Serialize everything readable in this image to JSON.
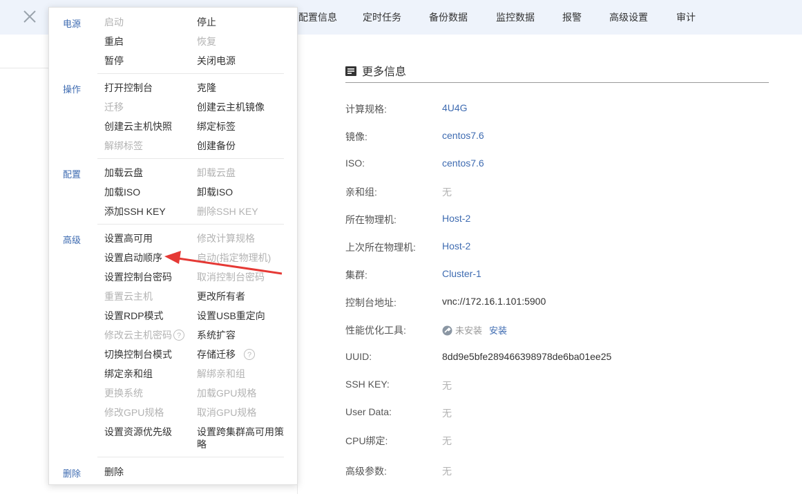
{
  "tabs": [
    "配置信息",
    "定时任务",
    "备份数据",
    "监控数据",
    "报警",
    "高级设置",
    "审计"
  ],
  "menu": {
    "groups": {
      "power": "电源",
      "ops": "操作",
      "config": "配置",
      "advanced": "高级",
      "delete": "删除"
    },
    "power": {
      "start": "启动",
      "stop": "停止",
      "restart": "重启",
      "resume": "恢复",
      "pause": "暂停",
      "poweroff": "关闭电源"
    },
    "ops": {
      "open_console": "打开控制台",
      "clone": "克隆",
      "migrate": "迁移",
      "create_image": "创建云主机镜像",
      "create_snapshot": "创建云主机快照",
      "bind_tag": "绑定标签",
      "unbind_tag": "解绑标签",
      "create_backup": "创建备份"
    },
    "config": {
      "attach_disk": "加载云盘",
      "detach_disk": "卸载云盘",
      "attach_iso": "加载ISO",
      "detach_iso": "卸载ISO",
      "add_ssh": "添加SSH KEY",
      "delete_ssh": "删除SSH KEY"
    },
    "advanced": {
      "set_ha": "设置高可用",
      "change_spec": "修改计算规格",
      "set_boot_order": "设置启动顺序",
      "start_on_host": "启动(指定物理机)",
      "set_console_pwd": "设置控制台密码",
      "cancel_console_pwd": "取消控制台密码",
      "reset_vm": "重置云主机",
      "change_owner": "更改所有者",
      "set_rdp": "设置RDP模式",
      "set_usb_redirect": "设置USB重定向",
      "change_vm_pwd": "修改云主机密码",
      "expand_disk": "系统扩容",
      "switch_console": "切换控制台模式",
      "storage_migrate": "存储迁移",
      "bind_affinity": "绑定亲和组",
      "unbind_affinity": "解绑亲和组",
      "change_os": "更换系统",
      "attach_gpu": "加载GPU规格",
      "change_gpu": "修改GPU规格",
      "cancel_gpu": "取消GPU规格",
      "set_priority": "设置资源优先级",
      "set_cross_cluster_ha": "设置跨集群高可用策略"
    },
    "delete": {
      "delete": "删除"
    },
    "help_glyph": "?"
  },
  "info": {
    "title": "更多信息",
    "rows": {
      "spec": {
        "label": "计算规格:",
        "value": "4U4G"
      },
      "image": {
        "label": "镜像:",
        "value": "centos7.6"
      },
      "iso": {
        "label": "ISO:",
        "value": "centos7.6"
      },
      "affinity": {
        "label": "亲和组:",
        "value": "无"
      },
      "host": {
        "label": "所在物理机:",
        "value": "Host-2"
      },
      "last_host": {
        "label": "上次所在物理机:",
        "value": "Host-2"
      },
      "cluster": {
        "label": "集群:",
        "value": "Cluster-1"
      },
      "console": {
        "label": "控制台地址:",
        "value": "vnc://172.16.1.101:5900"
      },
      "perf": {
        "label": "性能优化工具:",
        "status": "未安装",
        "action": "安装"
      },
      "uuid": {
        "label": "UUID:",
        "value": "8dd9e5bfe289466398978de6ba01ee25"
      },
      "ssh": {
        "label": "SSH KEY:",
        "value": "无"
      },
      "userdata": {
        "label": "User Data:",
        "value": "无"
      },
      "cpu_bind": {
        "label": "CPU绑定:",
        "value": "无"
      },
      "adv_params": {
        "label": "高级参数:",
        "value": "无"
      }
    }
  },
  "colors": {
    "accent": "#3e6bb1",
    "disabled": "#b3b3b3",
    "arrow": "#e53935",
    "topbar": "#eef3fb"
  }
}
